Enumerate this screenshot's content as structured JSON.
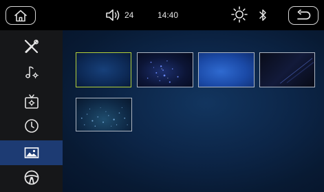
{
  "status_bar": {
    "volume": "24",
    "time": "14:40"
  },
  "icons": {
    "home": "home-icon",
    "volume": "speaker-icon",
    "brightness": "sun-icon",
    "bluetooth": "bluetooth-icon",
    "back": "return-arrow-icon"
  },
  "sidebar": {
    "items": [
      {
        "icon": "tools-icon"
      },
      {
        "icon": "music-settings-icon"
      },
      {
        "icon": "tv-settings-icon"
      },
      {
        "icon": "clock-icon"
      },
      {
        "icon": "wallpaper-icon",
        "active": true
      },
      {
        "icon": "steering-wheel-icon"
      }
    ]
  },
  "wallpapers": {
    "count": 5,
    "selected_index": 0
  },
  "colors": {
    "active_item": "#1d3b73",
    "selected_border": "#b6d23a",
    "sidebar_bg": "#161719"
  }
}
